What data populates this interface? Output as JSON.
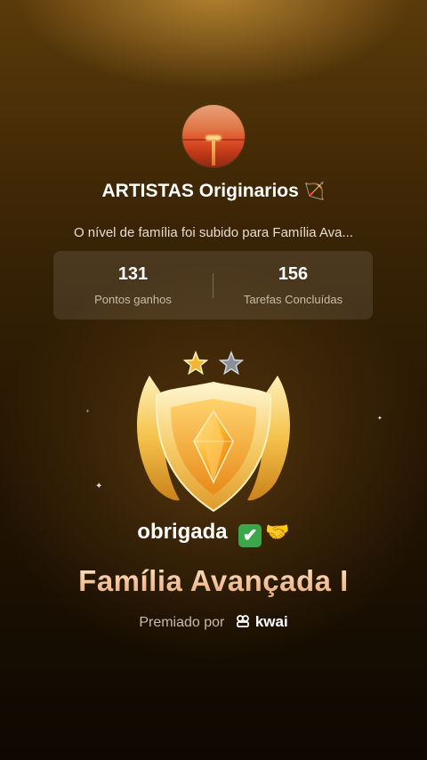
{
  "profile": {
    "name": "ARTISTAS Originarios",
    "name_emoji": "🏹"
  },
  "notice": "O nível de família foi subido para Família Ava...",
  "stats": {
    "points_value": "131",
    "points_label": "Pontos ganhos",
    "tasks_value": "156",
    "tasks_label": "Tarefas Concluídas"
  },
  "badge": {
    "stars_total": 2,
    "stars_earned": 1,
    "colors": {
      "gold": "#f2b632",
      "silver": "#8a8f99"
    }
  },
  "message": {
    "text": "obrigada",
    "check": "✔",
    "hands": "🤝"
  },
  "level_title": "Família Avançada I",
  "awarded": {
    "prefix": "Premiado por",
    "brand": "kwai"
  }
}
